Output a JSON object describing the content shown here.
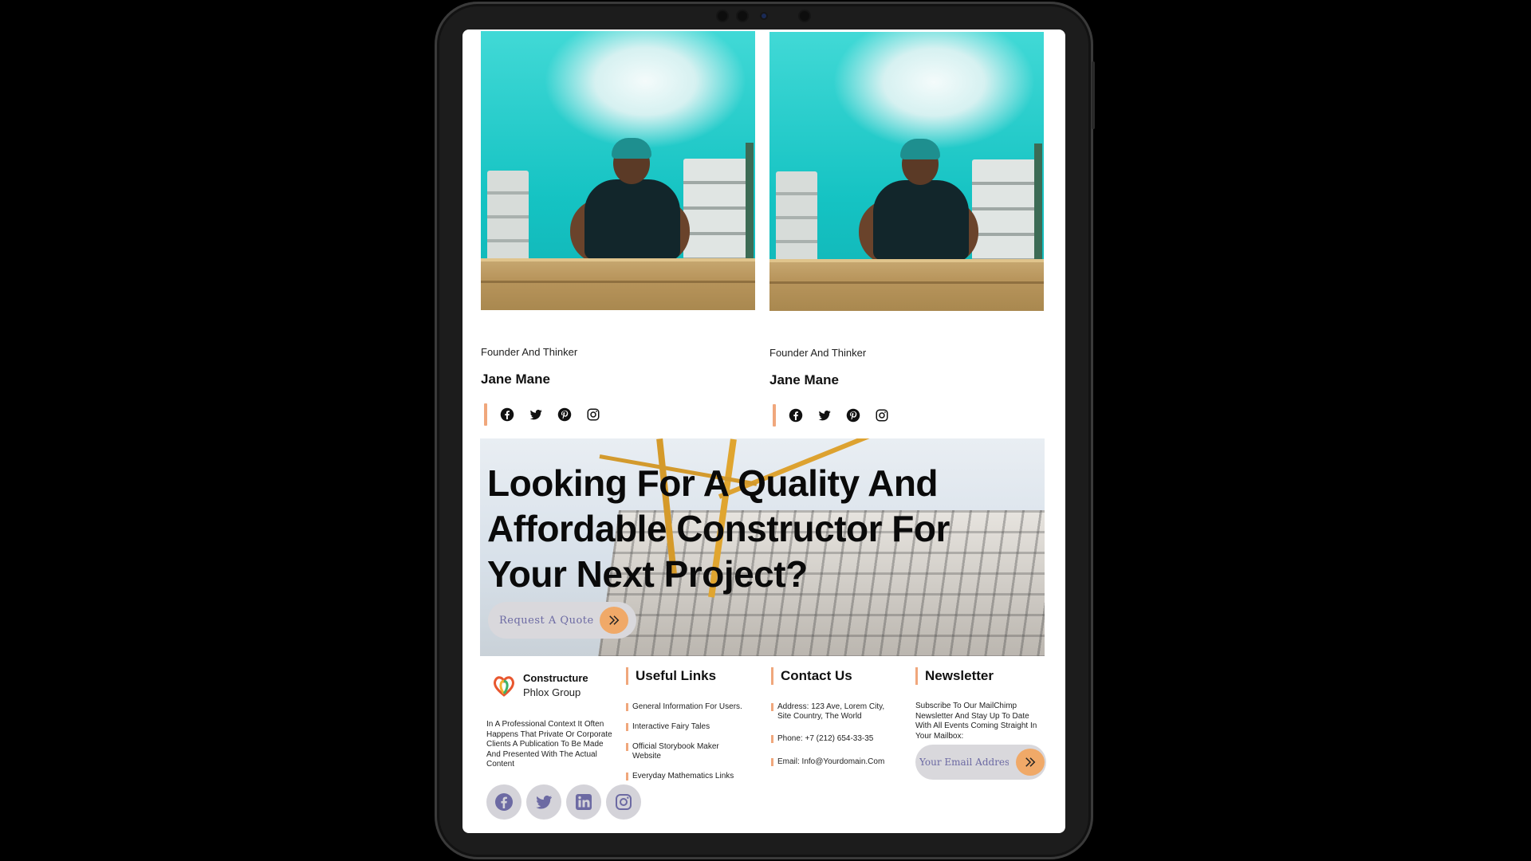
{
  "team": [
    {
      "role": "Founder And Thinker",
      "name": "Jane Mane"
    },
    {
      "role": "Founder And Thinker",
      "name": "Jane Mane"
    }
  ],
  "banner": {
    "heading": "Looking For A Quality And Affordable Constructor For Your Next Project?",
    "button_label": "Request A Quote"
  },
  "footer": {
    "brand": {
      "name": "Constructure",
      "sub": "Phlox Group"
    },
    "about": "In A Professional Context It Often Happens That Private Or Corporate Clients A Publication To Be Made And Presented With The Actual Content",
    "useful_links": {
      "title": "Useful Links",
      "items": [
        "General Information For Users.",
        "Interactive Fairy Tales",
        "Official Storybook Maker Website",
        "Everyday Mathematics Links"
      ]
    },
    "contact": {
      "title": "Contact Us",
      "address": "Address: 123 Ave, Lorem City, Site Country, The World",
      "phone": "Phone: +7 (212) 654-33-35",
      "email": "Email: Info@Yourdomain.Com"
    },
    "newsletter": {
      "title": "Newsletter",
      "text": "Subscribe To Our MailChimp Newsletter And Stay Up To Date With All Events Coming Straight In Your Mailbox:",
      "email_placeholder": "Your Email Address"
    }
  },
  "colors": {
    "accent_orange": "#f0a968",
    "accent_bar": "#f0a77c",
    "button_bg": "#d9d8dc",
    "button_text": "#6c6aa3"
  }
}
